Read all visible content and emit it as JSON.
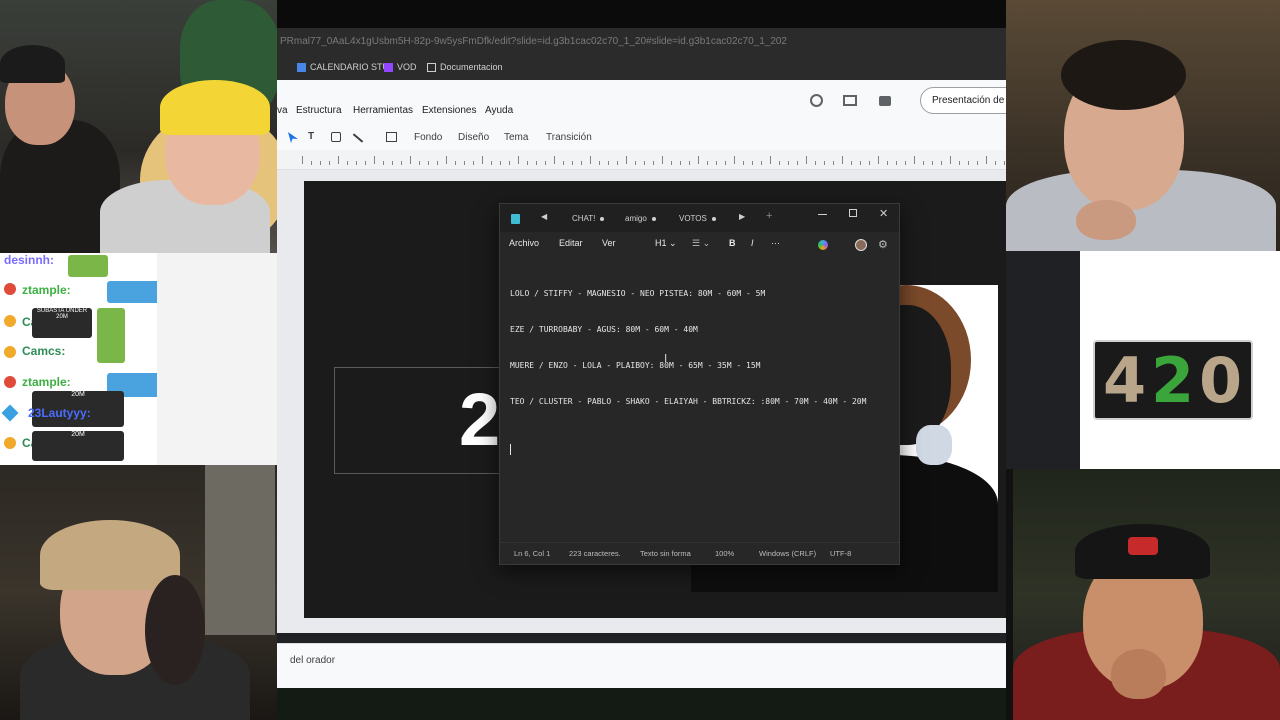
{
  "browser": {
    "url": "PRmal77_0AaL4x1gUsbm5H-82p-9w5ysFmDfk/edit?slide=id.g3b1cac02c70_1_20#slide=id.g3b1cac02c70_1_202",
    "bookmarks": [
      "CALENDARIO STU",
      "VOD",
      "Documentacion"
    ]
  },
  "slides": {
    "menu": [
      "va",
      "Estructura",
      "Herramientas",
      "Extensiones",
      "Ayuda"
    ],
    "toolbar": [
      "Fondo",
      "Diseño",
      "Tema",
      "Transición"
    ],
    "present_button": "Presentación de",
    "slide_big_text": "2",
    "speaker_notes_label": "del orador"
  },
  "notepad": {
    "tabs": [
      {
        "label": "CHAT!",
        "dot": true
      },
      {
        "label": "amigo",
        "dot": true
      },
      {
        "label": "VOTOS",
        "dot": true
      }
    ],
    "menu": [
      "Archivo",
      "Editar",
      "Ver"
    ],
    "heading_select": "H1",
    "lines": [
      "LOLO / STIFFY - MAGNESIO - NEO PISTEA: 80M - 60M - 5M",
      "EZE / TURROBABY - AGUS: 80M - 60M - 40M",
      "MUERE / ENZO - LOLA - PLAIBOY: 80M - 65M - 35M - 15M",
      "TEO / CLUSTER - PABLO - SHAKO - ELAIYAH - BBTRICKZ: :80M - 70M - 40M - 20M"
    ],
    "status": {
      "position": "Ln 6, Col 1",
      "chars": "223 caracteres.",
      "format": "Texto sin forma",
      "zoom": "100%",
      "line_ending": "Windows (CRLF)",
      "encoding": "UTF-8"
    }
  },
  "chat": {
    "messages": [
      {
        "user": "desinnh:",
        "color": "#7a6cff"
      },
      {
        "user": "ztample:",
        "color": "#3cb043"
      },
      {
        "user": "Camcs:",
        "color": "#2e8b57"
      },
      {
        "user": "Camcs:",
        "color": "#2e8b57"
      },
      {
        "user": "ztample:",
        "color": "#3cb043"
      },
      {
        "user": "23Lautyyy:",
        "color": "#4a6cff"
      },
      {
        "user": "Camcs:",
        "color": "#2e8b57"
      }
    ],
    "emote_texts": [
      "20M",
      "SUBASTA UNDER",
      "20M",
      "20M"
    ]
  },
  "overlay": {
    "logo_text": [
      "4",
      "2",
      "0"
    ]
  }
}
